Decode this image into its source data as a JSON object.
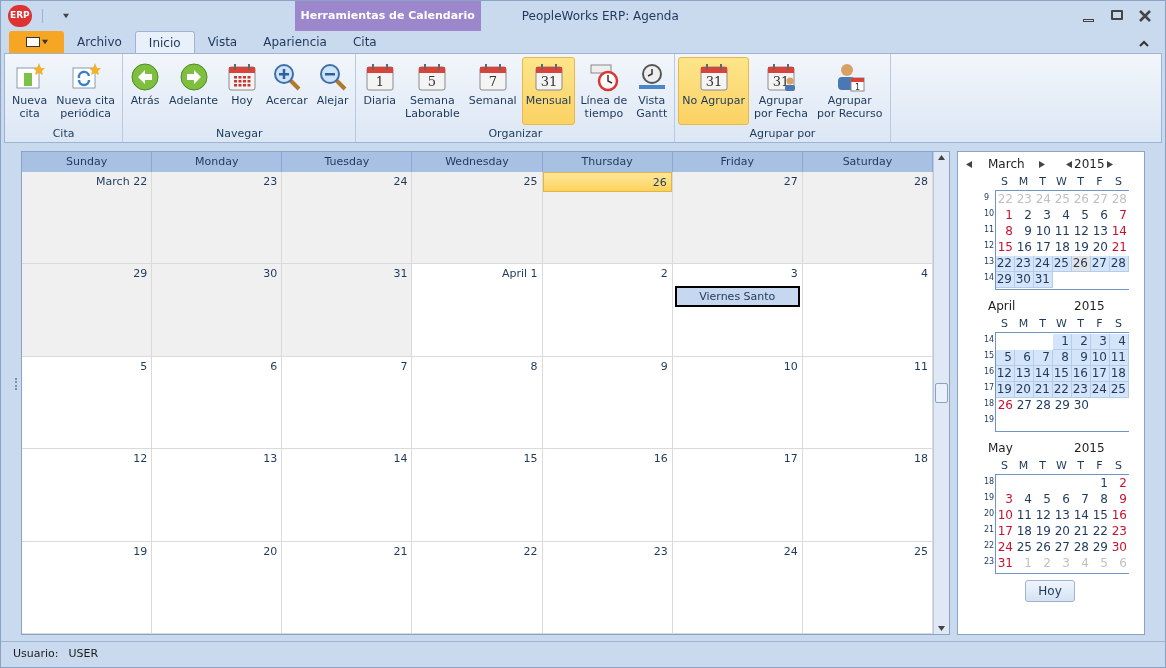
{
  "window": {
    "logo": "ERP",
    "context_title": "Herramientas de Calendario",
    "title": "PeopleWorks ERP: Agenda"
  },
  "tabs": [
    {
      "label": "Archivo",
      "selected": false
    },
    {
      "label": "Inicio",
      "selected": true
    },
    {
      "label": "Vista",
      "selected": false
    },
    {
      "label": "Apariencia",
      "selected": false
    },
    {
      "label": "Cita",
      "selected": false
    }
  ],
  "ribbon": [
    {
      "label": "Cita",
      "buttons": [
        {
          "label": "Nueva\ncita",
          "selected": false
        },
        {
          "label": "Nueva cita\nperiódica",
          "selected": false
        }
      ]
    },
    {
      "label": "Navegar",
      "buttons": [
        {
          "label": "Atrás",
          "selected": false
        },
        {
          "label": "Adelante",
          "selected": false
        },
        {
          "label": "Hoy",
          "selected": false
        },
        {
          "label": "Acercar",
          "selected": false
        },
        {
          "label": "Alejar",
          "selected": false
        }
      ]
    },
    {
      "label": "Organizar",
      "buttons": [
        {
          "label": "Diaria",
          "selected": false,
          "glyph": "1"
        },
        {
          "label": "Semana\nLaborable",
          "selected": false,
          "glyph": "5"
        },
        {
          "label": "Semanal",
          "selected": false,
          "glyph": "7"
        },
        {
          "label": "Mensual",
          "selected": true,
          "glyph": "31"
        },
        {
          "label": "Línea de\ntiempo",
          "selected": false
        },
        {
          "label": "Vista\nGantt",
          "selected": false
        }
      ]
    },
    {
      "label": "Agrupar por",
      "buttons": [
        {
          "label": "No Agrupar",
          "selected": true,
          "glyph": "31"
        },
        {
          "label": "Agrupar\npor Fecha",
          "selected": false,
          "glyph": "31"
        },
        {
          "label": "Agrupar\npor Recurso",
          "selected": false,
          "glyph": "1"
        }
      ]
    }
  ],
  "calendar": {
    "columns": [
      "Sunday",
      "Monday",
      "Tuesday",
      "Wednesday",
      "Thursday",
      "Friday",
      "Saturday"
    ],
    "weeks": [
      [
        {
          "label": "March 22",
          "in_month": false,
          "today": false
        },
        {
          "label": "23",
          "in_month": false,
          "today": false
        },
        {
          "label": "24",
          "in_month": false,
          "today": false
        },
        {
          "label": "25",
          "in_month": false,
          "today": false
        },
        {
          "label": "26",
          "in_month": false,
          "today": true
        },
        {
          "label": "27",
          "in_month": false,
          "today": false
        },
        {
          "label": "28",
          "in_month": false,
          "today": false
        }
      ],
      [
        {
          "label": "29",
          "in_month": false,
          "today": false
        },
        {
          "label": "30",
          "in_month": false,
          "today": false
        },
        {
          "label": "31",
          "in_month": false,
          "today": false
        },
        {
          "label": "April 1",
          "in_month": true,
          "today": false
        },
        {
          "label": "2",
          "in_month": true,
          "today": false
        },
        {
          "label": "3",
          "in_month": true,
          "today": false,
          "appointments": [
            "Viernes Santo"
          ]
        },
        {
          "label": "4",
          "in_month": true,
          "today": false
        }
      ],
      [
        {
          "label": "5",
          "in_month": true,
          "today": false
        },
        {
          "label": "6",
          "in_month": true,
          "today": false
        },
        {
          "label": "7",
          "in_month": true,
          "today": false
        },
        {
          "label": "8",
          "in_month": true,
          "today": false
        },
        {
          "label": "9",
          "in_month": true,
          "today": false
        },
        {
          "label": "10",
          "in_month": true,
          "today": false
        },
        {
          "label": "11",
          "in_month": true,
          "today": false
        }
      ],
      [
        {
          "label": "12",
          "in_month": true,
          "today": false
        },
        {
          "label": "13",
          "in_month": true,
          "today": false
        },
        {
          "label": "14",
          "in_month": true,
          "today": false
        },
        {
          "label": "15",
          "in_month": true,
          "today": false
        },
        {
          "label": "16",
          "in_month": true,
          "today": false
        },
        {
          "label": "17",
          "in_month": true,
          "today": false
        },
        {
          "label": "18",
          "in_month": true,
          "today": false
        }
      ],
      [
        {
          "label": "19",
          "in_month": true,
          "today": false
        },
        {
          "label": "20",
          "in_month": true,
          "today": false
        },
        {
          "label": "21",
          "in_month": true,
          "today": false
        },
        {
          "label": "22",
          "in_month": true,
          "today": false
        },
        {
          "label": "23",
          "in_month": true,
          "today": false
        },
        {
          "label": "24",
          "in_month": true,
          "today": false
        },
        {
          "label": "25",
          "in_month": true,
          "today": false
        }
      ]
    ]
  },
  "date_navigator": {
    "button": "Hoy",
    "months": [
      {
        "month": "March",
        "year": "2015",
        "weekdays": [
          "S",
          "M",
          "T",
          "W",
          "T",
          "F",
          "S"
        ],
        "weeks": [
          {
            "number": "9",
            "days": [
              {
                "text": "22",
                "kind": "other",
                "selected": false,
                "today": false
              },
              {
                "text": "23",
                "kind": "other",
                "selected": false,
                "today": false
              },
              {
                "text": "24",
                "kind": "other",
                "selected": false,
                "today": false
              },
              {
                "text": "25",
                "kind": "other",
                "selected": false,
                "today": false
              },
              {
                "text": "26",
                "kind": "other",
                "selected": false,
                "today": false
              },
              {
                "text": "27",
                "kind": "other",
                "selected": false,
                "today": false
              },
              {
                "text": "28",
                "kind": "other",
                "selected": false,
                "today": false
              }
            ]
          },
          {
            "number": "10",
            "days": [
              {
                "text": "1",
                "kind": "weekend",
                "selected": false,
                "today": false
              },
              {
                "text": "2",
                "kind": "normal",
                "selected": false,
                "today": false
              },
              {
                "text": "3",
                "kind": "normal",
                "selected": false,
                "today": false
              },
              {
                "text": "4",
                "kind": "normal",
                "selected": false,
                "today": false
              },
              {
                "text": "5",
                "kind": "normal",
                "selected": false,
                "today": false
              },
              {
                "text": "6",
                "kind": "normal",
                "selected": false,
                "today": false
              },
              {
                "text": "7",
                "kind": "weekend",
                "selected": false,
                "today": false
              }
            ]
          },
          {
            "number": "11",
            "days": [
              {
                "text": "8",
                "kind": "weekend",
                "selected": false,
                "today": false
              },
              {
                "text": "9",
                "kind": "normal",
                "selected": false,
                "today": false
              },
              {
                "text": "10",
                "kind": "normal",
                "selected": false,
                "today": false
              },
              {
                "text": "11",
                "kind": "normal",
                "selected": false,
                "today": false
              },
              {
                "text": "12",
                "kind": "normal",
                "selected": false,
                "today": false
              },
              {
                "text": "13",
                "kind": "normal",
                "selected": false,
                "today": false
              },
              {
                "text": "14",
                "kind": "weekend",
                "selected": false,
                "today": false
              }
            ]
          },
          {
            "number": "12",
            "days": [
              {
                "text": "15",
                "kind": "weekend",
                "selected": false,
                "today": false
              },
              {
                "text": "16",
                "kind": "normal",
                "selected": false,
                "today": false
              },
              {
                "text": "17",
                "kind": "normal",
                "selected": false,
                "today": false
              },
              {
                "text": "18",
                "kind": "normal",
                "selected": false,
                "today": false
              },
              {
                "text": "19",
                "kind": "normal",
                "selected": false,
                "today": false
              },
              {
                "text": "20",
                "kind": "normal",
                "selected": false,
                "today": false
              },
              {
                "text": "21",
                "kind": "weekend",
                "selected": false,
                "today": false
              }
            ]
          },
          {
            "number": "13",
            "days": [
              {
                "text": "22",
                "kind": "normal",
                "selected": true,
                "today": false
              },
              {
                "text": "23",
                "kind": "normal",
                "selected": true,
                "today": false
              },
              {
                "text": "24",
                "kind": "normal",
                "selected": true,
                "today": false
              },
              {
                "text": "25",
                "kind": "normal",
                "selected": true,
                "today": false
              },
              {
                "text": "26",
                "kind": "normal",
                "selected": true,
                "today": true
              },
              {
                "text": "27",
                "kind": "normal",
                "selected": true,
                "today": false
              },
              {
                "text": "28",
                "kind": "normal",
                "selected": true,
                "today": false
              }
            ]
          },
          {
            "number": "14",
            "days": [
              {
                "text": "29",
                "kind": "normal",
                "selected": true,
                "today": false
              },
              {
                "text": "30",
                "kind": "normal",
                "selected": true,
                "today": false
              },
              {
                "text": "31",
                "kind": "normal",
                "selected": true,
                "today": false
              },
              {
                "kind": "blank"
              },
              {
                "kind": "blank"
              },
              {
                "kind": "blank"
              },
              {
                "kind": "blank"
              }
            ]
          }
        ]
      },
      {
        "month": "April",
        "year": "2015",
        "weekdays": [
          "S",
          "M",
          "T",
          "W",
          "T",
          "F",
          "S"
        ],
        "weeks": [
          {
            "number": "14",
            "days": [
              {
                "kind": "blank"
              },
              {
                "kind": "blank"
              },
              {
                "kind": "blank"
              },
              {
                "text": "1",
                "kind": "normal",
                "selected": true,
                "today": false
              },
              {
                "text": "2",
                "kind": "normal",
                "selected": true,
                "today": false
              },
              {
                "text": "3",
                "kind": "normal",
                "selected": true,
                "today": false
              },
              {
                "text": "4",
                "kind": "normal",
                "selected": true,
                "today": false
              }
            ]
          },
          {
            "number": "15",
            "days": [
              {
                "text": "5",
                "kind": "normal",
                "selected": true,
                "today": false
              },
              {
                "text": "6",
                "kind": "normal",
                "selected": true,
                "today": false
              },
              {
                "text": "7",
                "kind": "normal",
                "selected": true,
                "today": false
              },
              {
                "text": "8",
                "kind": "normal",
                "selected": true,
                "today": false
              },
              {
                "text": "9",
                "kind": "normal",
                "selected": true,
                "today": false
              },
              {
                "text": "10",
                "kind": "normal",
                "selected": true,
                "today": false
              },
              {
                "text": "11",
                "kind": "normal",
                "selected": true,
                "today": false
              }
            ]
          },
          {
            "number": "16",
            "days": [
              {
                "text": "12",
                "kind": "normal",
                "selected": true,
                "today": false
              },
              {
                "text": "13",
                "kind": "normal",
                "selected": true,
                "today": false
              },
              {
                "text": "14",
                "kind": "normal",
                "selected": true,
                "today": false
              },
              {
                "text": "15",
                "kind": "normal",
                "selected": true,
                "today": false
              },
              {
                "text": "16",
                "kind": "normal",
                "selected": true,
                "today": false
              },
              {
                "text": "17",
                "kind": "normal",
                "selected": true,
                "today": false
              },
              {
                "text": "18",
                "kind": "normal",
                "selected": true,
                "today": false
              }
            ]
          },
          {
            "number": "17",
            "days": [
              {
                "text": "19",
                "kind": "normal",
                "selected": true,
                "today": false
              },
              {
                "text": "20",
                "kind": "normal",
                "selected": true,
                "today": false
              },
              {
                "text": "21",
                "kind": "normal",
                "selected": true,
                "today": false
              },
              {
                "text": "22",
                "kind": "normal",
                "selected": true,
                "today": false
              },
              {
                "text": "23",
                "kind": "normal",
                "selected": true,
                "today": false
              },
              {
                "text": "24",
                "kind": "normal",
                "selected": true,
                "today": false
              },
              {
                "text": "25",
                "kind": "normal",
                "selected": true,
                "today": false
              }
            ]
          },
          {
            "number": "18",
            "days": [
              {
                "text": "26",
                "kind": "weekend",
                "selected": false,
                "today": false
              },
              {
                "text": "27",
                "kind": "normal",
                "selected": false,
                "today": false
              },
              {
                "text": "28",
                "kind": "normal",
                "selected": false,
                "today": false
              },
              {
                "text": "29",
                "kind": "normal",
                "selected": false,
                "today": false
              },
              {
                "text": "30",
                "kind": "normal",
                "selected": false,
                "today": false
              },
              {
                "kind": "blank"
              },
              {
                "kind": "blank"
              }
            ]
          },
          {
            "number": "19",
            "days": [
              {
                "kind": "blank"
              },
              {
                "kind": "blank"
              },
              {
                "kind": "blank"
              },
              {
                "kind": "blank"
              },
              {
                "kind": "blank"
              },
              {
                "kind": "blank"
              },
              {
                "kind": "blank"
              }
            ]
          }
        ]
      },
      {
        "month": "May",
        "year": "2015",
        "weekdays": [
          "S",
          "M",
          "T",
          "W",
          "T",
          "F",
          "S"
        ],
        "weeks": [
          {
            "number": "18",
            "days": [
              {
                "kind": "blank"
              },
              {
                "kind": "blank"
              },
              {
                "kind": "blank"
              },
              {
                "kind": "blank"
              },
              {
                "kind": "blank"
              },
              {
                "text": "1",
                "kind": "normal",
                "selected": false,
                "today": false
              },
              {
                "text": "2",
                "kind": "weekend",
                "selected": false,
                "today": false
              }
            ]
          },
          {
            "number": "19",
            "days": [
              {
                "text": "3",
                "kind": "weekend",
                "selected": false,
                "today": false
              },
              {
                "text": "4",
                "kind": "normal",
                "selected": false,
                "today": false
              },
              {
                "text": "5",
                "kind": "normal",
                "selected": false,
                "today": false
              },
              {
                "text": "6",
                "kind": "normal",
                "selected": false,
                "today": false
              },
              {
                "text": "7",
                "kind": "normal",
                "selected": false,
                "today": false
              },
              {
                "text": "8",
                "kind": "normal",
                "selected": false,
                "today": false
              },
              {
                "text": "9",
                "kind": "weekend",
                "selected": false,
                "today": false
              }
            ]
          },
          {
            "number": "20",
            "days": [
              {
                "text": "10",
                "kind": "weekend",
                "selected": false,
                "today": false
              },
              {
                "text": "11",
                "kind": "normal",
                "selected": false,
                "today": false
              },
              {
                "text": "12",
                "kind": "normal",
                "selected": false,
                "today": false
              },
              {
                "text": "13",
                "kind": "normal",
                "selected": false,
                "today": false
              },
              {
                "text": "14",
                "kind": "normal",
                "selected": false,
                "today": false
              },
              {
                "text": "15",
                "kind": "normal",
                "selected": false,
                "today": false
              },
              {
                "text": "16",
                "kind": "weekend",
                "selected": false,
                "today": false
              }
            ]
          },
          {
            "number": "21",
            "days": [
              {
                "text": "17",
                "kind": "weekend",
                "selected": false,
                "today": false
              },
              {
                "text": "18",
                "kind": "normal",
                "selected": false,
                "today": false
              },
              {
                "text": "19",
                "kind": "normal",
                "selected": false,
                "today": false
              },
              {
                "text": "20",
                "kind": "normal",
                "selected": false,
                "today": false
              },
              {
                "text": "21",
                "kind": "normal",
                "selected": false,
                "today": false
              },
              {
                "text": "22",
                "kind": "normal",
                "selected": false,
                "today": false
              },
              {
                "text": "23",
                "kind": "weekend",
                "selected": false,
                "today": false
              }
            ]
          },
          {
            "number": "22",
            "days": [
              {
                "text": "24",
                "kind": "weekend",
                "selected": false,
                "today": false
              },
              {
                "text": "25",
                "kind": "normal",
                "selected": false,
                "today": false
              },
              {
                "text": "26",
                "kind": "normal",
                "selected": false,
                "today": false
              },
              {
                "text": "27",
                "kind": "normal",
                "selected": false,
                "today": false
              },
              {
                "text": "28",
                "kind": "normal",
                "selected": false,
                "today": false
              },
              {
                "text": "29",
                "kind": "normal",
                "selected": false,
                "today": false
              },
              {
                "text": "30",
                "kind": "weekend",
                "selected": false,
                "today": false
              }
            ]
          },
          {
            "number": "23",
            "days": [
              {
                "text": "31",
                "kind": "weekend",
                "selected": false,
                "today": false
              },
              {
                "text": "1",
                "kind": "other",
                "selected": false,
                "today": false
              },
              {
                "text": "2",
                "kind": "other",
                "selected": false,
                "today": false
              },
              {
                "text": "3",
                "kind": "other",
                "selected": false,
                "today": false
              },
              {
                "text": "4",
                "kind": "other",
                "selected": false,
                "today": false
              },
              {
                "text": "5",
                "kind": "other",
                "selected": false,
                "today": false
              },
              {
                "text": "6",
                "kind": "other",
                "selected": false,
                "today": false
              }
            ]
          }
        ]
      }
    ]
  },
  "status_bar": {
    "label": "Usuario:",
    "value": "USER"
  }
}
